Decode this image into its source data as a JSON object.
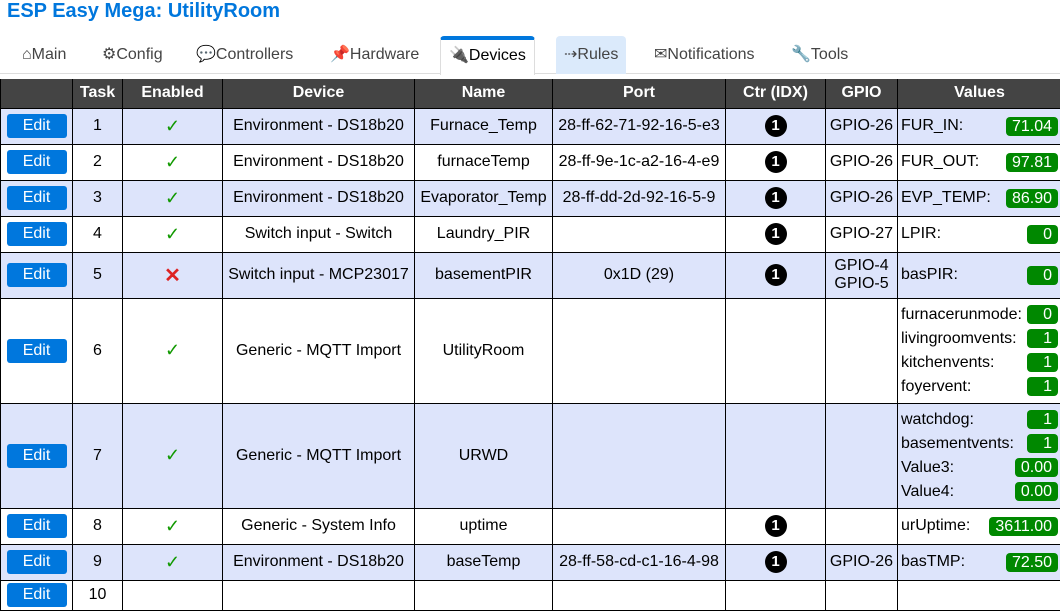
{
  "title": "ESP Easy Mega: UtilityRoom",
  "tabs": [
    {
      "icon": "⌂",
      "label": "Main",
      "name": "home"
    },
    {
      "icon": "⚙",
      "label": "Config",
      "name": "gear"
    },
    {
      "icon": "💬",
      "label": "Controllers",
      "name": "chat"
    },
    {
      "icon": "📌",
      "label": "Hardware",
      "name": "pin"
    },
    {
      "icon": "🔌",
      "label": "Devices",
      "name": "plug"
    },
    {
      "icon": "⇢",
      "label": "Rules",
      "name": "arrow"
    },
    {
      "icon": "✉",
      "label": "Notifications",
      "name": "envelope"
    },
    {
      "icon": "🔧",
      "label": "Tools",
      "name": "wrench"
    }
  ],
  "headers": [
    "",
    "Task",
    "Enabled",
    "Device",
    "Name",
    "Port",
    "Ctr (IDX)",
    "GPIO",
    "Values"
  ],
  "edit_label": "Edit",
  "rows": [
    {
      "task": "1",
      "enabled": true,
      "device": "Environment - DS18b20",
      "name": "Furnace_Temp",
      "port": "28-ff-62-71-92-16-5-e3",
      "ctr": "1",
      "gpio": [
        "GPIO-26"
      ],
      "values": [
        [
          "FUR_IN:",
          "71.04"
        ]
      ]
    },
    {
      "task": "2",
      "enabled": true,
      "device": "Environment - DS18b20",
      "name": "furnaceTemp",
      "port": "28-ff-9e-1c-a2-16-4-e9",
      "ctr": "1",
      "gpio": [
        "GPIO-26"
      ],
      "values": [
        [
          "FUR_OUT:",
          "97.81"
        ]
      ]
    },
    {
      "task": "3",
      "enabled": true,
      "device": "Environment - DS18b20",
      "name": "Evaporator_Temp",
      "port": "28-ff-dd-2d-92-16-5-9",
      "ctr": "1",
      "gpio": [
        "GPIO-26"
      ],
      "values": [
        [
          "EVP_TEMP:",
          "86.90"
        ]
      ]
    },
    {
      "task": "4",
      "enabled": true,
      "device": "Switch input - Switch",
      "name": "Laundry_PIR",
      "port": "",
      "ctr": "1",
      "gpio": [
        "GPIO-27"
      ],
      "values": [
        [
          "LPIR:",
          "0"
        ]
      ]
    },
    {
      "task": "5",
      "enabled": false,
      "device": "Switch input - MCP23017",
      "name": "basementPIR",
      "port": "0x1D (29)",
      "ctr": "1",
      "gpio": [
        "GPIO-4",
        "GPIO-5"
      ],
      "values": [
        [
          "basPIR:",
          "0"
        ]
      ]
    },
    {
      "task": "6",
      "enabled": true,
      "device": "Generic - MQTT Import",
      "name": "UtilityRoom",
      "port": "",
      "ctr": "",
      "gpio": [],
      "values": [
        [
          "furnacerunmode:",
          "0"
        ],
        [
          "livingroomvents:",
          "1"
        ],
        [
          "kitchenvents:",
          "1"
        ],
        [
          "foyervent:",
          "1"
        ]
      ]
    },
    {
      "task": "7",
      "enabled": true,
      "device": "Generic - MQTT Import",
      "name": "URWD",
      "port": "",
      "ctr": "",
      "gpio": [],
      "values": [
        [
          "watchdog:",
          "1"
        ],
        [
          "basementvents:",
          "1"
        ],
        [
          "Value3:",
          "0.00"
        ],
        [
          "Value4:",
          "0.00"
        ]
      ]
    },
    {
      "task": "8",
      "enabled": true,
      "device": "Generic - System Info",
      "name": "uptime",
      "port": "",
      "ctr": "1",
      "gpio": [],
      "values": [
        [
          "urUptime:",
          "3611.00"
        ]
      ]
    },
    {
      "task": "9",
      "enabled": true,
      "device": "Environment - DS18b20",
      "name": "baseTemp",
      "port": "28-ff-58-cd-c1-16-4-98",
      "ctr": "1",
      "gpio": [
        "GPIO-26"
      ],
      "values": [
        [
          "basTMP:",
          "72.50"
        ]
      ]
    },
    {
      "task": "10",
      "enabled": null,
      "device": "",
      "name": "",
      "port": "",
      "ctr": "",
      "gpio": [],
      "values": []
    }
  ],
  "check_glyph": "✓",
  "cross_glyph": "✕"
}
